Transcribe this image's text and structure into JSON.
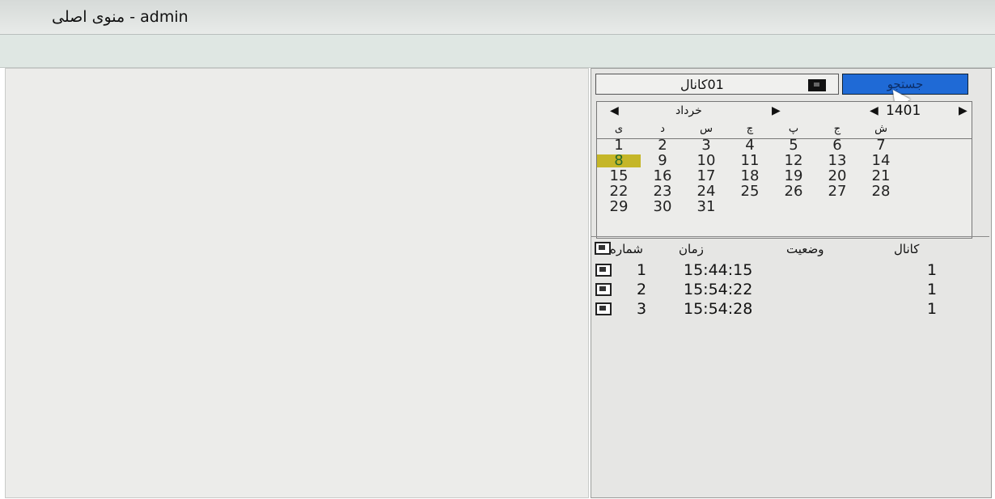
{
  "title": {
    "text": "منوی اصلی - admin"
  },
  "top_panel": {
    "channel_label": "01کانال",
    "search_button": "جستجو"
  },
  "calendar": {
    "year": "1401",
    "month": "خرداد",
    "weekdays": [
      "ی",
      "د",
      "س",
      "چ",
      "پ",
      "ج",
      "ش"
    ],
    "weeks": [
      [
        "1",
        "2",
        "3",
        "4",
        "5",
        "6",
        "7"
      ],
      [
        "8",
        "9",
        "10",
        "11",
        "12",
        "13",
        "14"
      ],
      [
        "15",
        "16",
        "17",
        "18",
        "19",
        "20",
        "21"
      ],
      [
        "22",
        "23",
        "24",
        "25",
        "26",
        "27",
        "28"
      ],
      [
        "29",
        "30",
        "31",
        "",
        "",
        "",
        ""
      ]
    ],
    "selected_day": "8",
    "selected_color": "#c5b628"
  },
  "recordings": {
    "headers": [
      "شماره",
      "زمان",
      "وضعیت",
      "کانال"
    ],
    "rows": [
      {
        "number": "1",
        "time": "15:44:15",
        "status": "",
        "channel": "1"
      },
      {
        "number": "2",
        "time": "15:54:22",
        "status": "",
        "channel": "1"
      },
      {
        "number": "3",
        "time": "15:54:28",
        "status": "",
        "channel": "1"
      }
    ]
  }
}
